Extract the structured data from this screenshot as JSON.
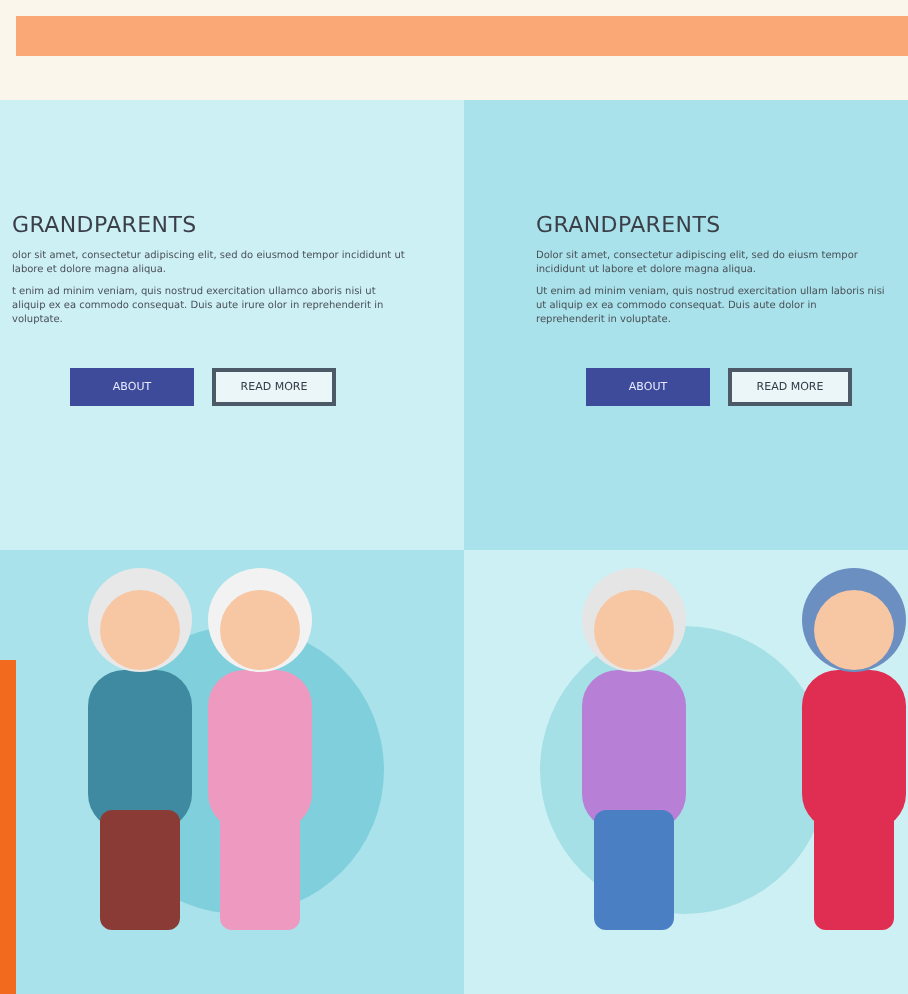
{
  "banners": [
    {
      "title": "GRANDPARENTS",
      "paragraphs": [
        "olor sit amet, consectetur adipiscing elit, sed do eiusmod tempor incididunt ut labore et dolore magna aliqua.",
        "t enim ad minim veniam, quis nostrud exercitation ullamco aboris nisi ut aliquip ex ea commodo consequat. Duis aute irure olor in reprehenderit in voluptate."
      ],
      "buttons": [
        {
          "label": "ABOUT",
          "kind": "filled"
        },
        {
          "label": "READ MORE",
          "kind": "outline"
        }
      ]
    },
    {
      "title": "GRANDPARENTS",
      "paragraphs": [
        "Dolor sit amet, consectetur adipiscing elit, sed do eiusm tempor incididunt ut labore et dolore magna aliqua.",
        "Ut enim ad minim veniam, quis nostrud exercitation ullam laboris nisi ut aliquip ex ea commodo consequat. Duis aute dolor in reprehenderit in voluptate."
      ],
      "buttons": [
        {
          "label": "ABOUT",
          "kind": "filled"
        },
        {
          "label": "READ MORE",
          "kind": "outline"
        }
      ]
    }
  ]
}
